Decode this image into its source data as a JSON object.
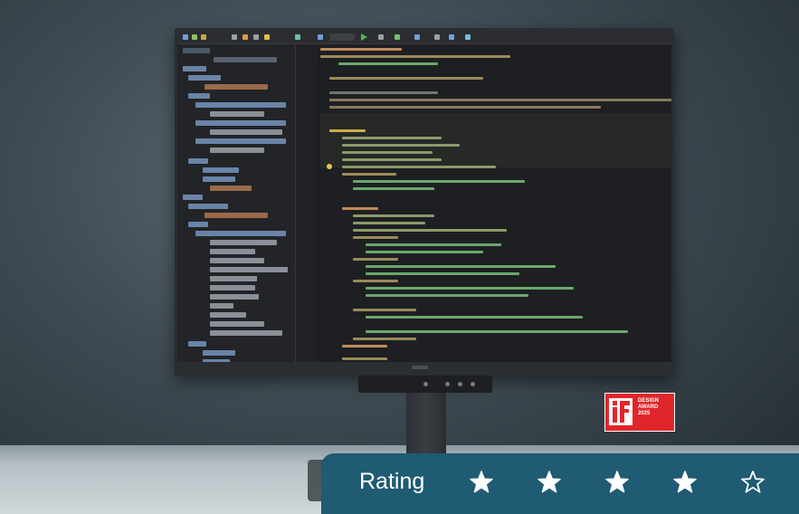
{
  "award": {
    "text": "DESIGN\nAWARD\n2025"
  },
  "rating": {
    "label": "Rating",
    "value": 4,
    "max": 5,
    "stars": [
      {
        "filled": true
      },
      {
        "filled": true
      },
      {
        "filled": true
      },
      {
        "filled": true
      },
      {
        "filled": false
      }
    ],
    "colors": {
      "panel": "#1f5b72",
      "star": "#ffffff"
    }
  },
  "icons": {
    "star_filled": "star-filled-icon",
    "star_empty": "star-outline-icon"
  }
}
